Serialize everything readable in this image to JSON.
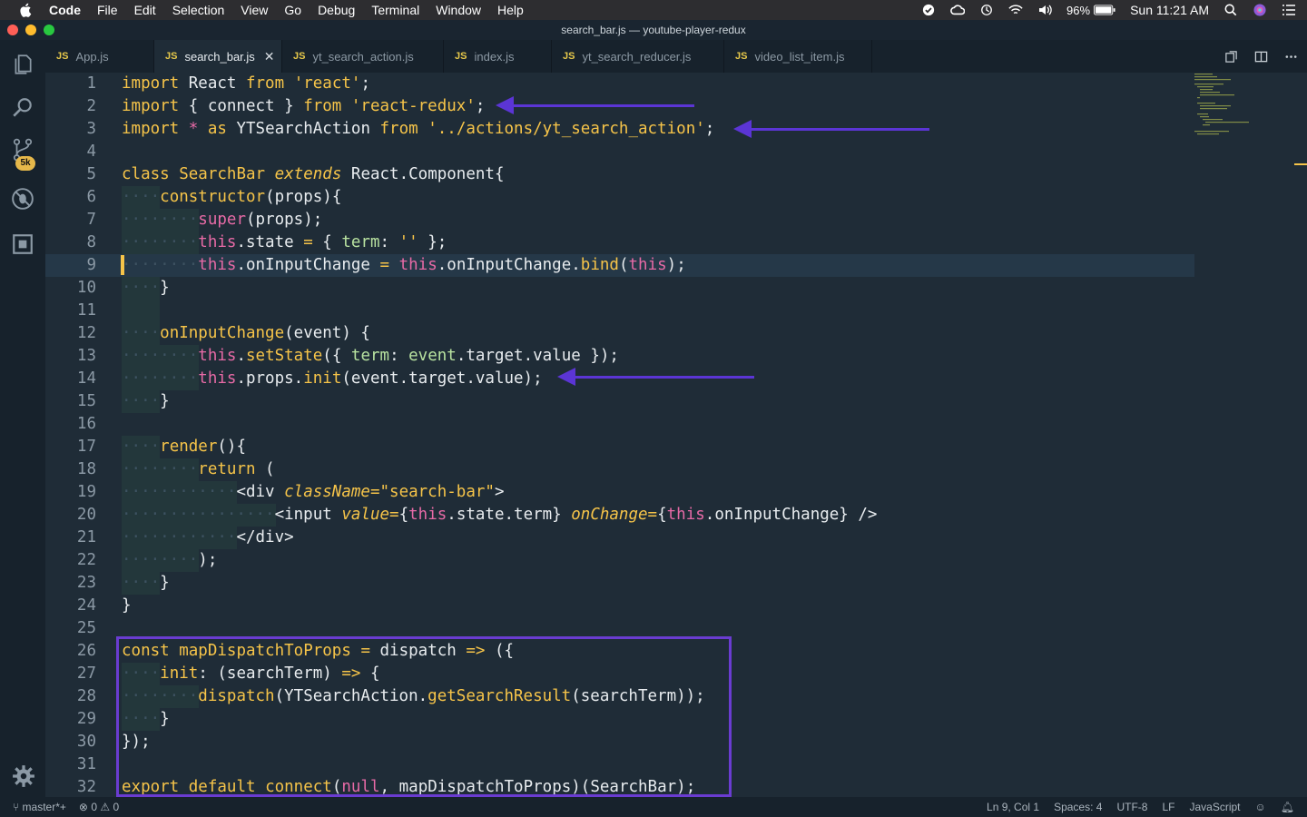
{
  "menubar": {
    "items": [
      "Code",
      "File",
      "Edit",
      "Selection",
      "View",
      "Go",
      "Debug",
      "Terminal",
      "Window",
      "Help"
    ],
    "battery": "96%",
    "clock": "Sun 11:21 AM"
  },
  "window": {
    "title": "search_bar.js — youtube-player-redux"
  },
  "tabs": [
    {
      "label": "App.js",
      "active": false
    },
    {
      "label": "search_bar.js",
      "active": true
    },
    {
      "label": "yt_search_action.js",
      "active": false
    },
    {
      "label": "index.js",
      "active": false
    },
    {
      "label": "yt_search_reducer.js",
      "active": false
    },
    {
      "label": "video_list_item.js",
      "active": false
    }
  ],
  "tab_badge": "JS",
  "activity": {
    "source_control_badge": "5k"
  },
  "editor": {
    "lines": [
      {
        "n": "1",
        "tokens": [
          [
            "kw",
            "import"
          ],
          [
            "id",
            " React "
          ],
          [
            "kw",
            "from"
          ],
          [
            "id",
            " "
          ],
          [
            "st",
            "'react'"
          ],
          [
            "id",
            ";"
          ]
        ]
      },
      {
        "n": "2",
        "tokens": [
          [
            "kw",
            "import"
          ],
          [
            "id",
            " { connect } "
          ],
          [
            "kw",
            "from"
          ],
          [
            "id",
            " "
          ],
          [
            "st",
            "'react-redux'"
          ],
          [
            "id",
            ";"
          ]
        ]
      },
      {
        "n": "3",
        "tokens": [
          [
            "kw",
            "import"
          ],
          [
            "id",
            " "
          ],
          [
            "th",
            "*"
          ],
          [
            "id",
            " "
          ],
          [
            "kw",
            "as"
          ],
          [
            "id",
            " YTSearchAction "
          ],
          [
            "kw",
            "from"
          ],
          [
            "id",
            " "
          ],
          [
            "st",
            "'../actions/yt_search_action'"
          ],
          [
            "id",
            ";"
          ]
        ]
      },
      {
        "n": "4",
        "tokens": []
      },
      {
        "n": "5",
        "tokens": [
          [
            "kw",
            "class"
          ],
          [
            "id",
            " "
          ],
          [
            "fn",
            "SearchBar"
          ],
          [
            "id",
            " "
          ],
          [
            "ex",
            "extends"
          ],
          [
            "id",
            " React.Component{"
          ]
        ]
      },
      {
        "n": "6",
        "tokens": [
          [
            "ws",
            "····"
          ],
          [
            "fn",
            "constructor"
          ],
          [
            "id",
            "(props){"
          ]
        ]
      },
      {
        "n": "7",
        "tokens": [
          [
            "ws",
            "········"
          ],
          [
            "th",
            "super"
          ],
          [
            "id",
            "(props);"
          ]
        ]
      },
      {
        "n": "8",
        "tokens": [
          [
            "ws",
            "········"
          ],
          [
            "th",
            "this"
          ],
          [
            "id",
            ".state "
          ],
          [
            "op",
            "="
          ],
          [
            "id",
            " { "
          ],
          [
            "pr",
            "term"
          ],
          [
            "id",
            ": "
          ],
          [
            "st",
            "''"
          ],
          [
            "id",
            " };"
          ]
        ]
      },
      {
        "n": "9",
        "tokens": [
          [
            "ws",
            "········"
          ],
          [
            "th",
            "this"
          ],
          [
            "id",
            ".onInputChange "
          ],
          [
            "op",
            "="
          ],
          [
            "id",
            " "
          ],
          [
            "th",
            "this"
          ],
          [
            "id",
            ".onInputChange."
          ],
          [
            "fn",
            "bind"
          ],
          [
            "id",
            "("
          ],
          [
            "th",
            "this"
          ],
          [
            "id",
            ");"
          ]
        ]
      },
      {
        "n": "10",
        "tokens": [
          [
            "ws",
            "····"
          ],
          [
            "id",
            "}"
          ]
        ]
      },
      {
        "n": "11",
        "tokens": []
      },
      {
        "n": "12",
        "tokens": [
          [
            "ws",
            "····"
          ],
          [
            "fn",
            "onInputChange"
          ],
          [
            "id",
            "(event) {"
          ]
        ]
      },
      {
        "n": "13",
        "tokens": [
          [
            "ws",
            "········"
          ],
          [
            "th",
            "this"
          ],
          [
            "id",
            "."
          ],
          [
            "fn",
            "setState"
          ],
          [
            "id",
            "({ "
          ],
          [
            "pr",
            "term"
          ],
          [
            "id",
            ": "
          ],
          [
            "pr",
            "event"
          ],
          [
            "id",
            ".target.value });"
          ]
        ]
      },
      {
        "n": "14",
        "tokens": [
          [
            "ws",
            "········"
          ],
          [
            "th",
            "this"
          ],
          [
            "id",
            ".props."
          ],
          [
            "fn",
            "init"
          ],
          [
            "id",
            "(event.target.value);"
          ]
        ]
      },
      {
        "n": "15",
        "tokens": [
          [
            "ws",
            "····"
          ],
          [
            "id",
            "}"
          ]
        ]
      },
      {
        "n": "16",
        "tokens": []
      },
      {
        "n": "17",
        "tokens": [
          [
            "ws",
            "····"
          ],
          [
            "fn",
            "render"
          ],
          [
            "id",
            "(){"
          ]
        ]
      },
      {
        "n": "18",
        "tokens": [
          [
            "ws",
            "········"
          ],
          [
            "kw",
            "return"
          ],
          [
            "id",
            " ("
          ]
        ]
      },
      {
        "n": "19",
        "tokens": [
          [
            "ws",
            "············"
          ],
          [
            "tg",
            "<div "
          ],
          [
            "at",
            "className"
          ],
          [
            "op",
            "="
          ],
          [
            "st",
            "\"search-bar\""
          ],
          [
            "tg",
            ">"
          ]
        ]
      },
      {
        "n": "20",
        "tokens": [
          [
            "ws",
            "················"
          ],
          [
            "tg",
            "<input "
          ],
          [
            "at",
            "value"
          ],
          [
            "op",
            "="
          ],
          [
            "id",
            "{"
          ],
          [
            "th",
            "this"
          ],
          [
            "id",
            ".state.term} "
          ],
          [
            "at",
            "onChange"
          ],
          [
            "op",
            "="
          ],
          [
            "id",
            "{"
          ],
          [
            "th",
            "this"
          ],
          [
            "id",
            ".onInputChange} />"
          ]
        ]
      },
      {
        "n": "21",
        "tokens": [
          [
            "ws",
            "············"
          ],
          [
            "tg",
            "</div>"
          ]
        ]
      },
      {
        "n": "22",
        "tokens": [
          [
            "ws",
            "········"
          ],
          [
            "id",
            ");"
          ]
        ]
      },
      {
        "n": "23",
        "tokens": [
          [
            "ws",
            "····"
          ],
          [
            "id",
            "}"
          ]
        ]
      },
      {
        "n": "24",
        "tokens": [
          [
            "id",
            "}"
          ]
        ]
      },
      {
        "n": "25",
        "tokens": []
      },
      {
        "n": "26",
        "tokens": [
          [
            "kw",
            "const"
          ],
          [
            "id",
            " "
          ],
          [
            "fn",
            "mapDispatchToProps"
          ],
          [
            "id",
            " "
          ],
          [
            "op",
            "="
          ],
          [
            "id",
            " dispatch "
          ],
          [
            "op",
            "=>"
          ],
          [
            "id",
            " ({"
          ]
        ]
      },
      {
        "n": "27",
        "tokens": [
          [
            "ws",
            "····"
          ],
          [
            "fn",
            "init"
          ],
          [
            "id",
            ": (searchTerm) "
          ],
          [
            "op",
            "=>"
          ],
          [
            "id",
            " {"
          ]
        ]
      },
      {
        "n": "28",
        "tokens": [
          [
            "ws",
            "········"
          ],
          [
            "fn",
            "dispatch"
          ],
          [
            "id",
            "(YTSearchAction."
          ],
          [
            "fn",
            "getSearchResult"
          ],
          [
            "id",
            "(searchTerm));"
          ]
        ]
      },
      {
        "n": "29",
        "tokens": [
          [
            "ws",
            "····"
          ],
          [
            "id",
            "}"
          ]
        ]
      },
      {
        "n": "30",
        "tokens": [
          [
            "id",
            "});"
          ]
        ]
      },
      {
        "n": "31",
        "tokens": []
      },
      {
        "n": "32",
        "tokens": [
          [
            "kw",
            "export"
          ],
          [
            "id",
            " "
          ],
          [
            "kw",
            "default"
          ],
          [
            "id",
            " "
          ],
          [
            "fn",
            "connect"
          ],
          [
            "id",
            "("
          ],
          [
            "th",
            "null"
          ],
          [
            "id",
            ", mapDispatchToProps)(SearchBar);"
          ]
        ]
      }
    ]
  },
  "statusbar": {
    "branch": "master*+",
    "errors": "0",
    "warnings": "0",
    "position": "Ln 9, Col 1",
    "spaces": "Spaces: 4",
    "encoding": "UTF-8",
    "eol": "LF",
    "language": "JavaScript"
  },
  "colors": {
    "accent": "#f6c449",
    "annotation": "#5b35d5",
    "background": "#1f2c37"
  }
}
